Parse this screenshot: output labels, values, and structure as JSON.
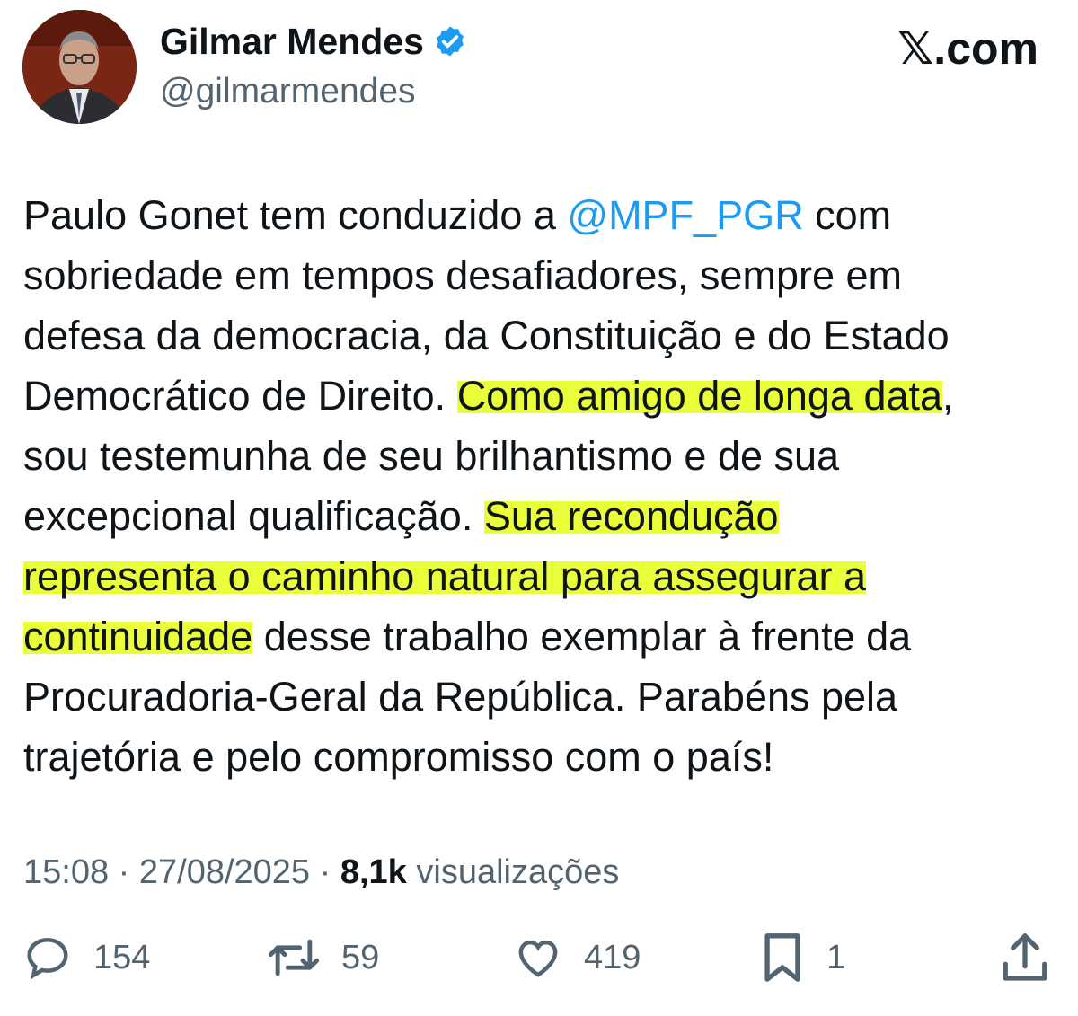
{
  "author": {
    "name": "Gilmar Mendes",
    "handle": "@gilmarmendes",
    "verified_icon": "verified-badge-icon"
  },
  "brand": {
    "x_glyph": "𝕏",
    "suffix": ".com"
  },
  "tweet": {
    "lines": [
      [
        "Paulo Gonet tem conduzido a ",
        "@MPF_PGR",
        " com"
      ],
      [
        "sobriedade em tempos desafiadores, sempre em"
      ],
      [
        "defesa da democracia, da Constituição e do Estado"
      ],
      [
        "Democrático de Direito. ",
        "Como amigo de longa data",
        ","
      ],
      [
        "sou testemunha de seu brilhantismo e de sua"
      ],
      [
        "excepcional qualificação. ",
        "Sua recondução"
      ],
      [
        "representa o caminho natural para assegurar a"
      ],
      [
        "continuidade",
        " desse trabalho exemplar à frente da"
      ],
      [
        "Procuradoria-Geral da República. Parabéns pela"
      ],
      [
        "trajetória e pelo compromisso com o país!"
      ]
    ]
  },
  "meta": {
    "time": "15:08",
    "sep": " · ",
    "date": "27/08/2025",
    "views": "8,1k",
    "views_label": " visualizações"
  },
  "actions": {
    "replies": "154",
    "reposts": "59",
    "likes": "419",
    "bookmarks": "1"
  },
  "colors": {
    "text": "#0f1419",
    "secondary": "#536471",
    "link": "#1d9bf0",
    "highlight": "#eaff3a",
    "verified": "#1d9bf0"
  }
}
